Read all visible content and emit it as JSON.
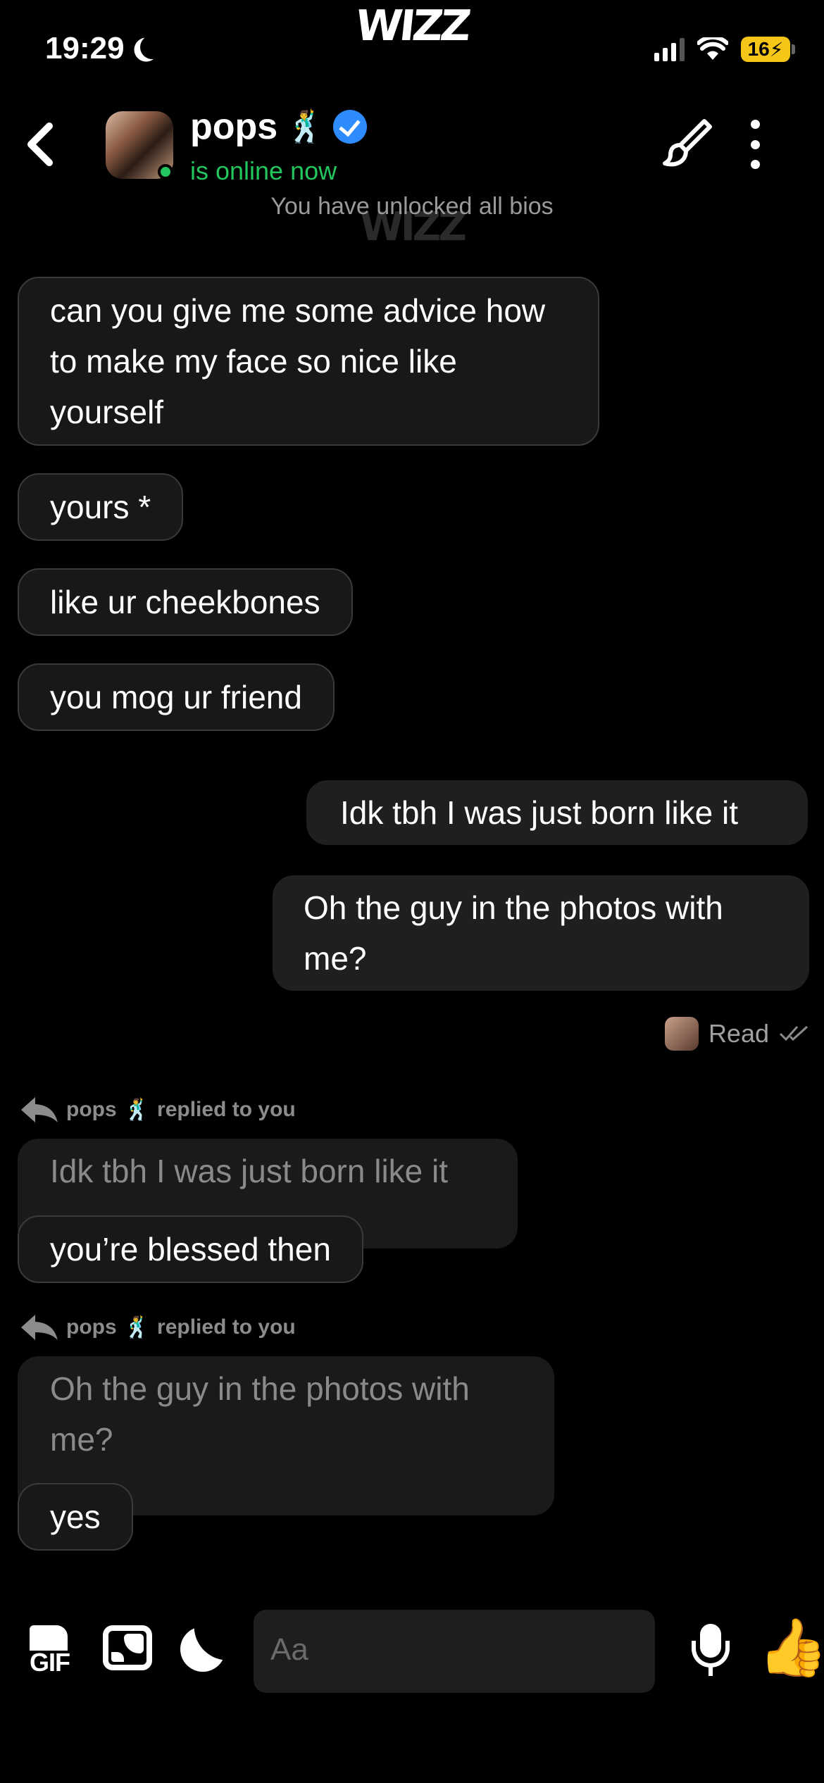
{
  "status_bar": {
    "time": "19:29",
    "battery": "16"
  },
  "brand": "WIZZ",
  "header": {
    "name": "pops",
    "name_emoji": "🕺",
    "online": "is online now",
    "unlocked": "You have unlocked all bios"
  },
  "messages": [
    {
      "side": "theirs",
      "text": "can you give me some advice how to make my face so nice like yourself"
    },
    {
      "side": "theirs",
      "text": "yours *"
    },
    {
      "side": "theirs",
      "text": "like ur cheekbones"
    },
    {
      "side": "theirs",
      "text": "you mog ur friend"
    },
    {
      "side": "mine",
      "text": "Idk tbh I was just born like it"
    },
    {
      "side": "mine",
      "text": "Oh the guy in the photos with me?"
    }
  ],
  "read_receipt": "Read",
  "replies": [
    {
      "name": "pops",
      "emoji": "🕺",
      "label": "replied to you",
      "quoted": "Idk tbh I was just born like it",
      "text": "you’re blessed then"
    },
    {
      "name": "pops",
      "emoji": "🕺",
      "label": "replied to you",
      "quoted": "Oh the guy in the photos with me?",
      "text": "yes"
    }
  ],
  "composer": {
    "gif_label": "GIF",
    "placeholder": "Aa",
    "thumb": "👍"
  }
}
